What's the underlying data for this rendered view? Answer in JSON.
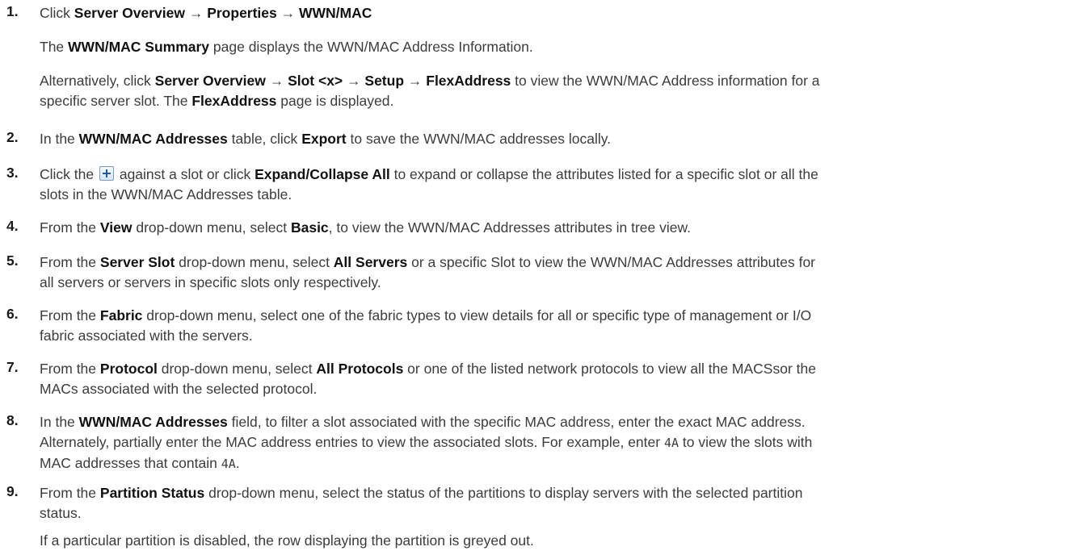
{
  "steps": [
    {
      "num": "1.",
      "t1": "Click ",
      "b1": "Server Overview",
      "t2": " → ",
      "b2": "Properties",
      "t3": " → ",
      "b3": "WWN/MAC",
      "p2_t1": "The ",
      "p2_b1": "WWN/MAC Summary",
      "p2_t2": " page displays the WWN/MAC Address Information.",
      "p3_t1": "Alternatively, click ",
      "p3_b1": "Server Overview",
      "p3_t2": " → ",
      "p3_b2": "Slot <x>",
      "p3_t3": " → ",
      "p3_b3": "Setup",
      "p3_t4": " → ",
      "p3_b4": "FlexAddress",
      "p3_t5": " to view the WWN/MAC Address information for a",
      "p3_l2_t1": "specific server slot. The ",
      "p3_l2_b1": "FlexAddress",
      "p3_l2_t2": " page is displayed."
    },
    {
      "num": "2.",
      "t1": "In the ",
      "b1": "WWN/MAC Addresses",
      "t2": " table, click ",
      "b2": "Export",
      "t3": " to save the WWN/MAC addresses locally."
    },
    {
      "num": "3.",
      "t1": "Click the ",
      "icon": "plus-icon",
      "t2": " against a slot or click ",
      "b1": "Expand/Collapse All",
      "t3": " to expand or collapse the attributes listed for a specific slot or all the",
      "l2": "slots in the WWN/MAC Addresses table."
    },
    {
      "num": "4.",
      "t1": "From the ",
      "b1": "View",
      "t2": " drop-down menu, select ",
      "b2": "Basic",
      "t3": ", to view the WWN/MAC Addresses attributes in tree view."
    },
    {
      "num": "5.",
      "t1": "From the ",
      "b1": "Server Slot",
      "t2": " drop-down menu, select ",
      "b2": "All Servers",
      "t3": " or a specific Slot to view the WWN/MAC Addresses attributes for",
      "l2": "all servers or servers in specific slots only respectively."
    },
    {
      "num": "6.",
      "t1": "From the ",
      "b1": "Fabric",
      "t2": " drop-down menu, select one of the fabric types to view details for all or specific type of management or I/O",
      "l2": "fabric associated with the servers."
    },
    {
      "num": "7.",
      "t1": "From the ",
      "b1": "Protocol",
      "t2": " drop-down menu, select ",
      "b2": "All Protocols",
      "t3": " or one of the listed network protocols to view all the MACSsor the",
      "l2": "MACs associated with the selected protocol."
    },
    {
      "num": "8.",
      "t1": "In the ",
      "b1": "WWN/MAC Addresses",
      "t2": " field, to filter a slot associated with the specific MAC address, enter the exact MAC address.",
      "l2": "Alternately, partially enter the MAC address entries to view the associated slots. For example, enter ",
      "code1": "4A",
      "l2b": " to view the slots with",
      "l3": "MAC addresses that contain ",
      "code2": "4A",
      "l3b": "."
    },
    {
      "num": "9.",
      "t1": "From the ",
      "b1": "Partition Status",
      "t2": " drop-down menu, select the status of the partitions to display servers with the selected partition",
      "l2": "status.",
      "p2": "If a particular partition is disabled, the row displaying the partition is greyed out."
    }
  ]
}
